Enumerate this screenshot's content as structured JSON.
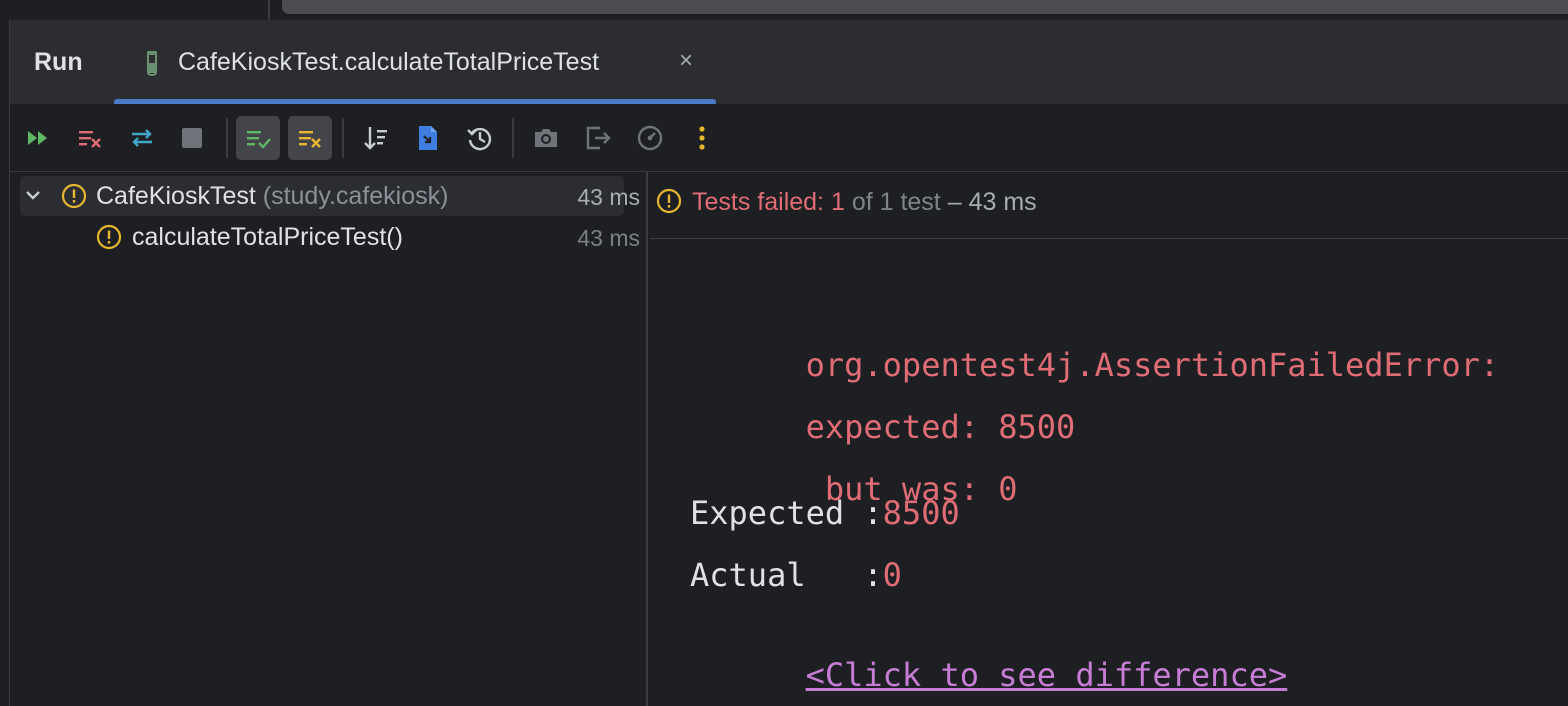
{
  "tool_window": {
    "title": "Run",
    "tab": {
      "label": "CafeKioskTest.calculateTotalPriceTest",
      "close": "×"
    }
  },
  "toolbar": {
    "buttons": [
      "rerun-icon",
      "rerun-failed-icon",
      "toggle-auto-test-icon",
      "stop-icon",
      "show-passed-icon",
      "show-ignored-icon",
      "sort-icon",
      "import-tests-icon",
      "history-icon",
      "screenshot-icon",
      "export-icon",
      "coverage-icon",
      "more-icon"
    ]
  },
  "tree": {
    "root": {
      "name": "CafeKioskTest",
      "package": "(study.cafekiosk)",
      "time": "43 ms"
    },
    "child": {
      "name": "calculateTotalPriceTest()",
      "time": "43 ms"
    }
  },
  "status": {
    "failed": "Tests failed: 1",
    "of": "of 1 test",
    "time": "– 43 ms"
  },
  "output": {
    "line1": "org.opentest4j.AssertionFailedError:",
    "line2": "expected: 8500",
    "line3": " but was: 0",
    "expected_label": "Expected :",
    "expected_value": "8500",
    "actual_label": "Actual   :",
    "actual_value": "0",
    "diff_link": "<Click to see difference>"
  },
  "colors": {
    "error": "#e06c75",
    "link": "#c77dd6",
    "accent": "#4b7ac8",
    "warning": "#e8b731"
  }
}
